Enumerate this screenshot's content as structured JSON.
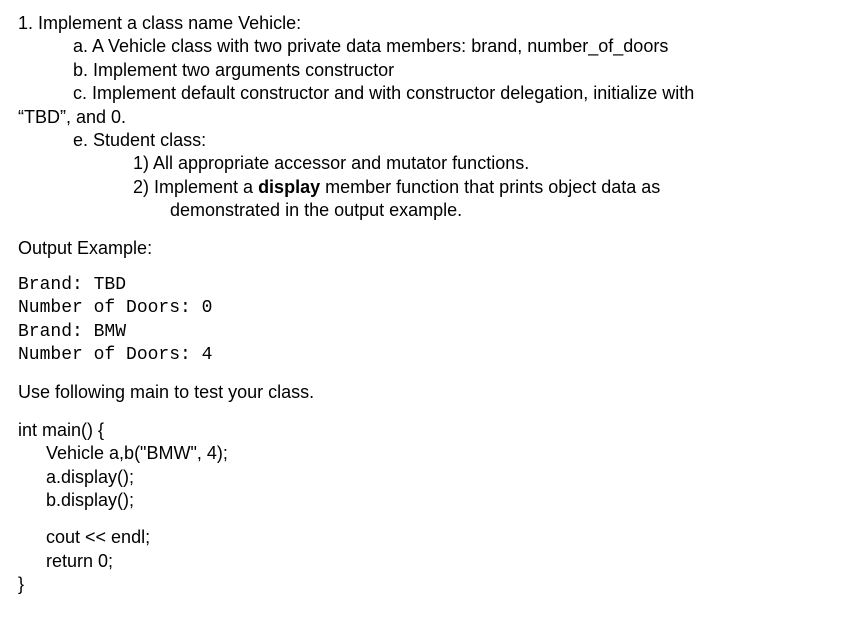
{
  "q1": {
    "title": "1. Implement a class name Vehicle:",
    "a": "a. A Vehicle class with two private data members: brand, number_of_doors",
    "b": "b. Implement two arguments constructor",
    "c": "c. Implement default constructor and with constructor delegation, initialize with",
    "c_tail": "“TBD”, and 0.",
    "e": "e. Student class:",
    "e1": "1) All appropriate accessor and mutator functions.",
    "e2_pre": "2) Implement a ",
    "e2_bold": "display",
    "e2_post": " member function that prints object data as",
    "e2_line2": "demonstrated in the output example."
  },
  "output_label": "Output Example:",
  "output": {
    "l1": "Brand: TBD",
    "l2": "Number of Doors: 0",
    "l3": "Brand: BMW",
    "l4": "Number of Doors: 4"
  },
  "use_main": "Use following main to test your class.",
  "code": {
    "l1": "int main() {",
    "l2": "Vehicle a,b(\"BMW\", 4);",
    "l3": "a.display();",
    "l4": "b.display();",
    "l5": "cout << endl;",
    "l6": "return 0;",
    "l7": "}"
  }
}
